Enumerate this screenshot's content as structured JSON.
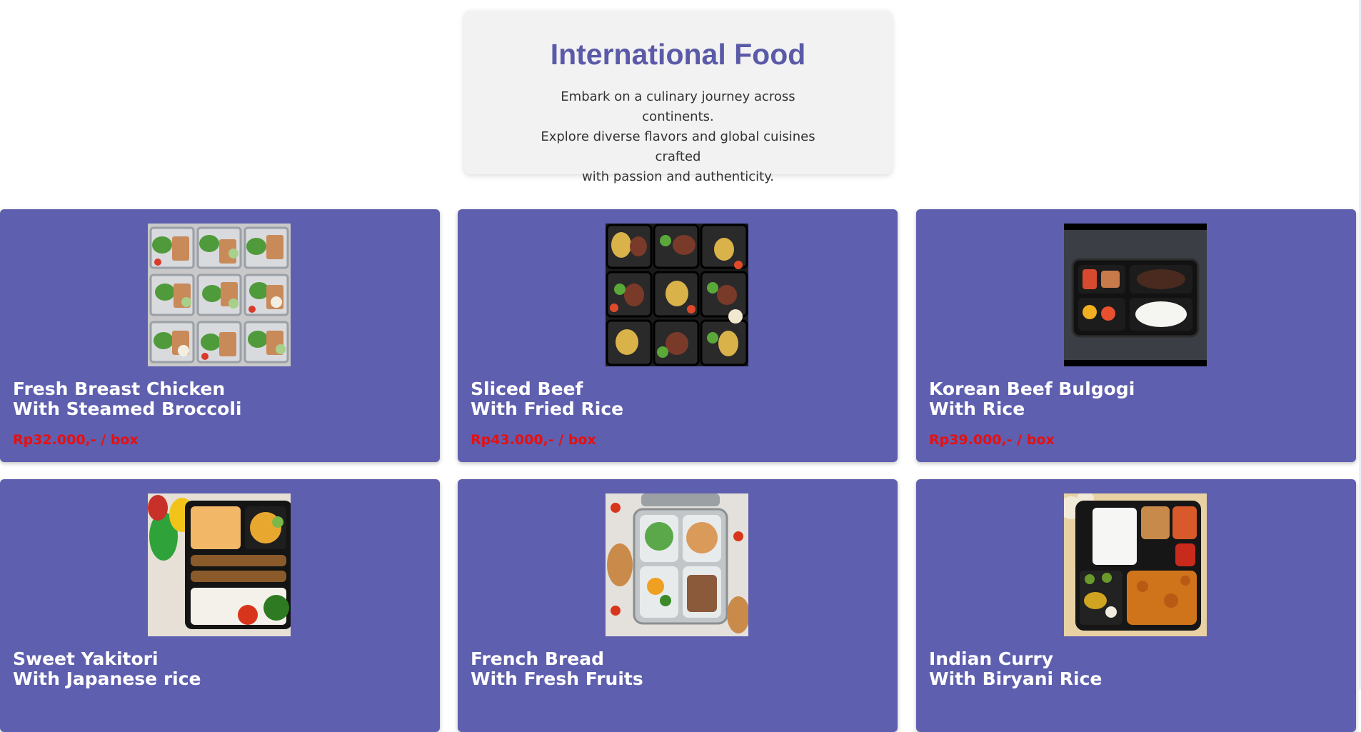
{
  "hero": {
    "title": "International Food",
    "description_line1": "Embark on a culinary journey across continents.",
    "description_line2": "Explore diverse flavors and global cuisines crafted",
    "description_line3": "with passion and authenticity."
  },
  "items": [
    {
      "name_line1": "Fresh Breast Chicken",
      "name_line2": "With Steamed Broccoli",
      "price": "Rp32.000,- / box",
      "image": "chicken-salad-meal-prep-photo"
    },
    {
      "name_line1": "Sliced Beef",
      "name_line2": "With Fried Rice",
      "price": "Rp43.000,- / box",
      "image": "beef-bowls-meal-prep-photo"
    },
    {
      "name_line1": "Korean Beef Bulgogi",
      "name_line2": "With Rice",
      "price": "Rp39.000,- / box",
      "image": "bulgogi-bento-photo"
    },
    {
      "name_line1": "Sweet Yakitori",
      "name_line2": "With Japanese rice",
      "image": "yakitori-bento-photo"
    },
    {
      "name_line1": "French Bread",
      "name_line2": "With Fresh Fruits",
      "image": "bread-fruit-lunchbox-photo"
    },
    {
      "name_line1": "Indian Curry",
      "name_line2": "With Biryani Rice",
      "image": "curry-biryani-platter-photo"
    }
  ],
  "colors": {
    "card_bg": "#5f5faf",
    "title_accent": "#5b5aa8",
    "price": "#e61010",
    "hero_bg": "#f2f2f2"
  }
}
